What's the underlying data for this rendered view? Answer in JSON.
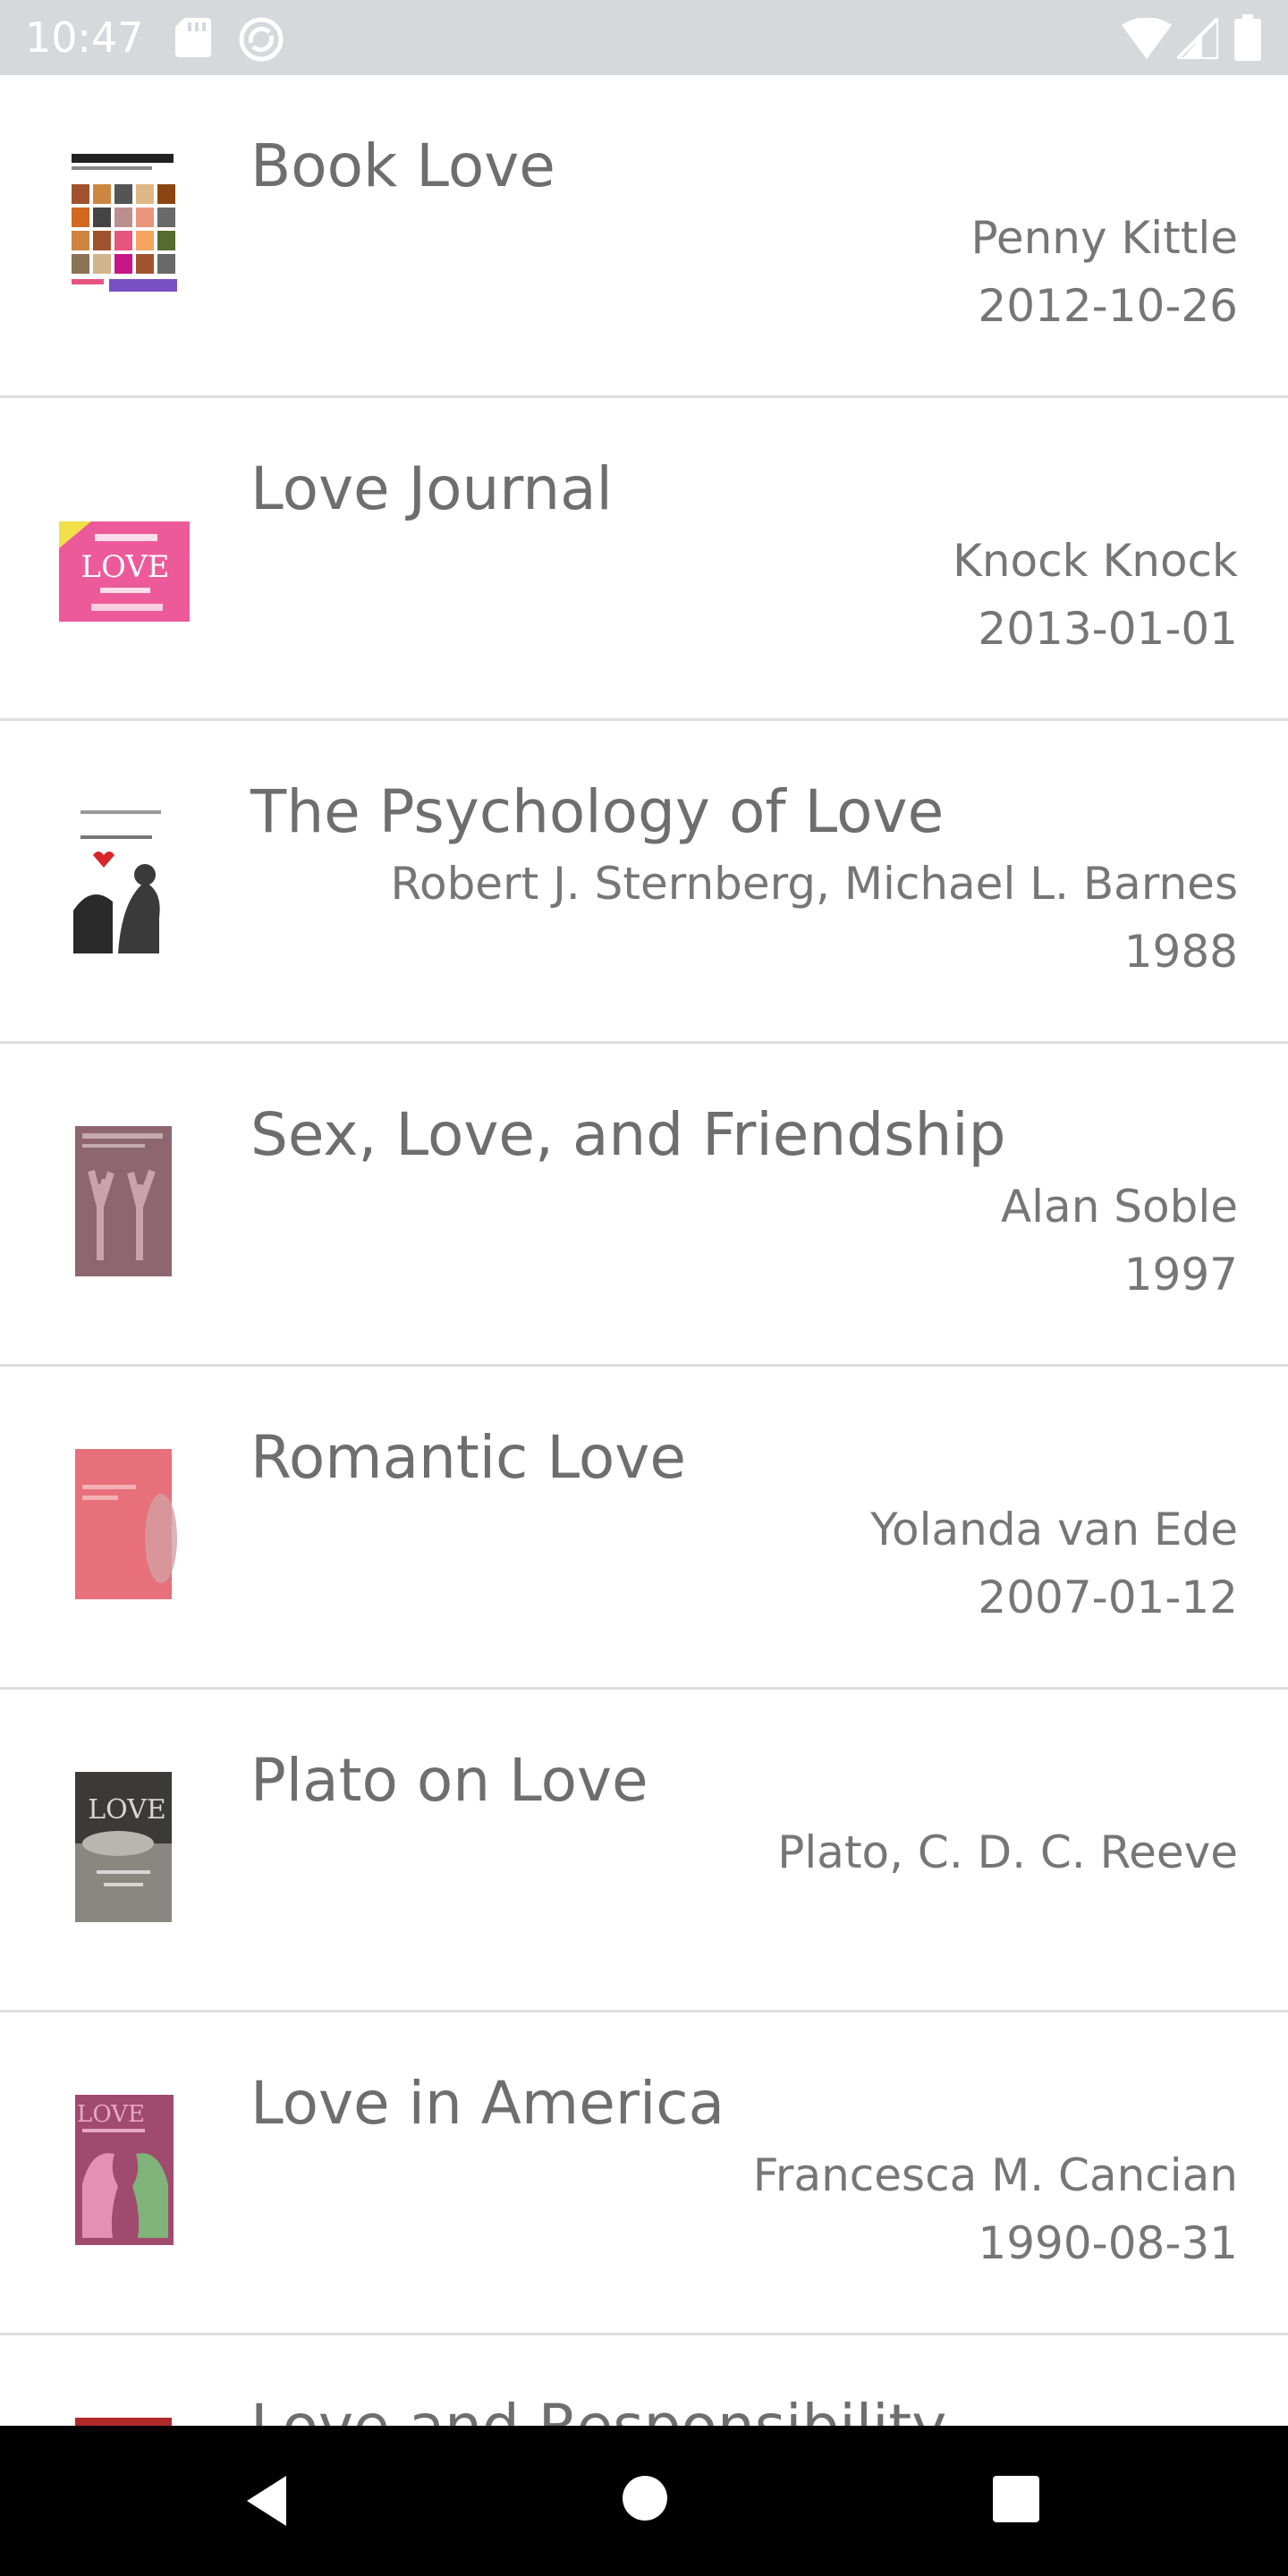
{
  "status_bar": {
    "time": "10:47",
    "icons": [
      "sd-card-icon",
      "sync-icon",
      "wifi-icon",
      "signal-icon",
      "battery-icon"
    ]
  },
  "books": [
    {
      "title": "Book Love",
      "author": "Penny Kittle",
      "date": "2012-10-26",
      "cover_icon": "book-cover-icon",
      "cover_color": "#ffffff"
    },
    {
      "title": "Love Journal",
      "author": "Knock Knock",
      "date": "2013-01-01",
      "cover_icon": "book-cover-icon",
      "cover_color": "#ec5a9a"
    },
    {
      "title": "The Psychology of Love",
      "author": "Robert J. Sternberg, Michael L. Barnes",
      "date": "1988",
      "cover_icon": "book-cover-icon",
      "cover_color": "#ffffff"
    },
    {
      "title": "Sex, Love, and Friendship",
      "author": "Alan Soble",
      "date": "1997",
      "cover_icon": "book-cover-icon",
      "cover_color": "#8e6670"
    },
    {
      "title": "Romantic Love",
      "author": "Yolanda van Ede",
      "date": "2007-01-12",
      "cover_icon": "book-cover-icon",
      "cover_color": "#e7707a"
    },
    {
      "title": "Plato on Love",
      "author": "Plato, C. D. C. Reeve",
      "date": "",
      "cover_icon": "book-cover-icon",
      "cover_color": "#8a8680"
    },
    {
      "title": "Love in America",
      "author": "Francesca M. Cancian",
      "date": "1990-08-31",
      "cover_icon": "book-cover-icon",
      "cover_color": "#a04a6e"
    },
    {
      "title": "Love and Responsibility",
      "author": "",
      "date": "",
      "cover_icon": "book-cover-icon",
      "cover_color": "#b02a2a"
    }
  ],
  "nav_bar": {
    "buttons": [
      "back-icon",
      "home-icon",
      "recents-icon"
    ]
  }
}
